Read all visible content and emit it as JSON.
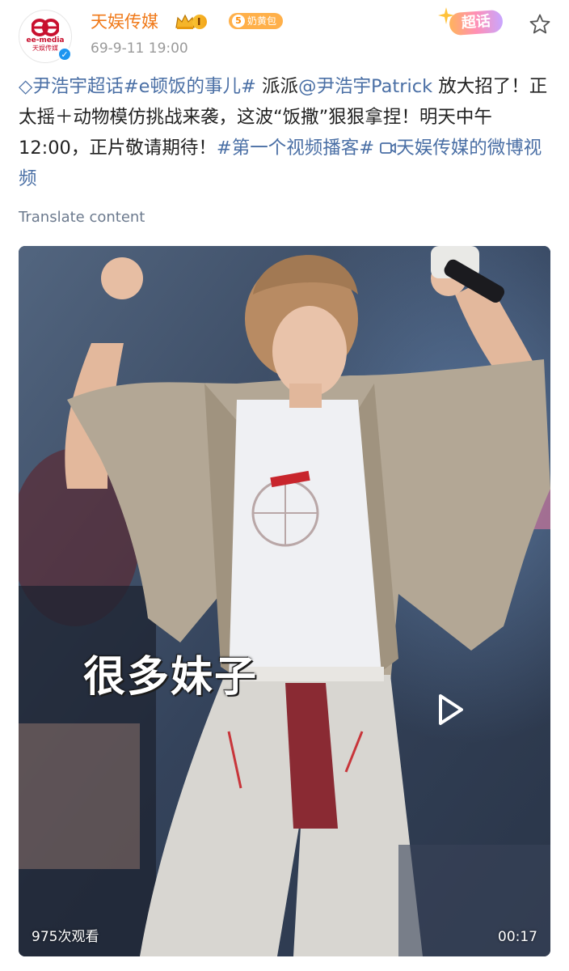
{
  "author": {
    "logo_text": "ee-media",
    "logo_cn": "天娱传媒",
    "name": "天娱传媒",
    "level": "I",
    "fan_badge_level": "5",
    "fan_badge_label": "奶黄包",
    "time": "69-9-11 19:00",
    "verified": true
  },
  "supertopic_label": "超话",
  "post": {
    "topic_icon": "◇",
    "topic1": "尹浩宇超话",
    "topic2": "#e顿饭的事儿#",
    "text1": " 派派",
    "mention": "@尹浩宇Patrick",
    "text2": " 放大招了！正太摇＋动物模仿挑战来袭，这波“饭撒”狠狠拿捏！明天中午12:00，正片敬请期待！",
    "topic3": "#第一个视频播客#",
    "video_link": "天娱传媒的微博视频"
  },
  "translate_label": "Translate content",
  "video": {
    "subtitle": "很多妹子",
    "views": "975次观看",
    "duration": "00:17"
  },
  "colors": {
    "orange_name": "#f07a1a",
    "link_blue": "#4a6fa5",
    "meta_gray": "#9a9a9a"
  }
}
